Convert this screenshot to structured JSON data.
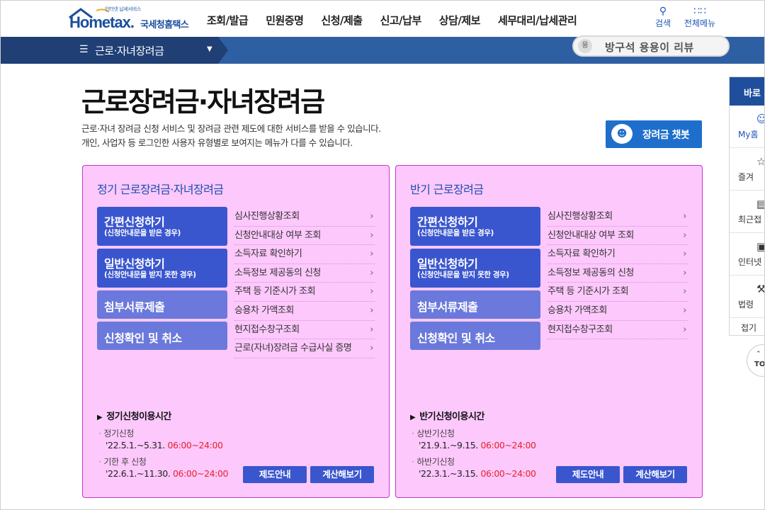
{
  "header": {
    "logo_tagline": "인터넷 납세서비스",
    "logo_brand": "Hometax.",
    "logo_korean": "국세청홈택스",
    "nav": [
      "조회/발급",
      "민원증명",
      "신청/제출",
      "신고/납부",
      "상담/제보",
      "세무대리/납세관리"
    ],
    "search_label": "검색",
    "allmenu_label": "전체메뉴"
  },
  "subbar": {
    "menu_label": "근로·자녀장려금",
    "badge_text": "방구석 용용이 리뷰",
    "badge_icon_text": "용"
  },
  "page": {
    "title": "근로장려금·자녀장려금",
    "desc_lines": [
      "근로·자녀 장려금 신청 서비스 및 장려금 관련 제도에 대한 서비스를 받을 수 있습니다.",
      "개인, 사업자 등 로그인한 사용자 유형별로 보여지는 메뉴가 다를 수 있습니다."
    ],
    "chatbot_label": "장려금 챗봇"
  },
  "panels": [
    {
      "title": "정기 근로장려금·자녀장려금",
      "buttons": [
        {
          "main": "간편신청하기",
          "sub": "(신청안내문을 받은 경우)"
        },
        {
          "main": "일반신청하기",
          "sub": "(신청안내문을 받지 못한 경우)"
        },
        {
          "main": "첨부서류제출",
          "sub": ""
        },
        {
          "main": "신청확인 및 취소",
          "sub": ""
        }
      ],
      "links": [
        "심사진행상황조회",
        "신청안내대상 여부 조회",
        "소득자료 확인하기",
        "소득정보 제공동의 신청",
        "주택 등 기준시가 조회",
        "승용차 가액조회",
        "현지접수창구조회",
        "근로(자녀)장려금 수급사실 증명"
      ],
      "hours_title": "정기신청이용시간",
      "hours": [
        {
          "label": "정기신청",
          "date": "'22.5.1.~5.31.",
          "time": "06:00~24:00"
        },
        {
          "label": "기한 후 신청",
          "date": "'22.6.1.~11.30.",
          "time": "06:00~24:00"
        }
      ],
      "btn_info": "제도안내",
      "btn_calc": "계산해보기"
    },
    {
      "title": "반기 근로장려금",
      "buttons": [
        {
          "main": "간편신청하기",
          "sub": "(신청안내문을 받은 경우)"
        },
        {
          "main": "일반신청하기",
          "sub": "(신청안내문을 받지 못한 경우)"
        },
        {
          "main": "첨부서류제출",
          "sub": ""
        },
        {
          "main": "신청확인 및 취소",
          "sub": ""
        }
      ],
      "links": [
        "심사진행상황조회",
        "신청안내대상 여부 조회",
        "소득자료 확인하기",
        "소득정보 제공동의 신청",
        "주택 등 기준시가 조회",
        "승용차 가액조회",
        "현지접수창구조회"
      ],
      "hours_title": "반기신청이용시간",
      "hours": [
        {
          "label": "상반기신청",
          "date": "'21.9.1.~9.15.",
          "time": "06:00~24:00"
        },
        {
          "label": "하반기신청",
          "date": "'22.3.1.~3.15.",
          "time": "06:00~24:00"
        }
      ],
      "btn_info": "제도안내",
      "btn_calc": "계산해보기"
    }
  ],
  "quick_menu": {
    "head": "바로",
    "items": [
      "My홈",
      "즐겨",
      "최근접",
      "인터넷",
      "법령",
      "접기"
    ],
    "top_label": "TO"
  },
  "colors": {
    "panel_bg": "#fdc8fc",
    "panel_border": "#c936c8",
    "primary_btn": "#3a56cf",
    "light_btn": "#6a79db",
    "time_red": "#e8222a",
    "subbar_blue": "#2f5fa3"
  }
}
